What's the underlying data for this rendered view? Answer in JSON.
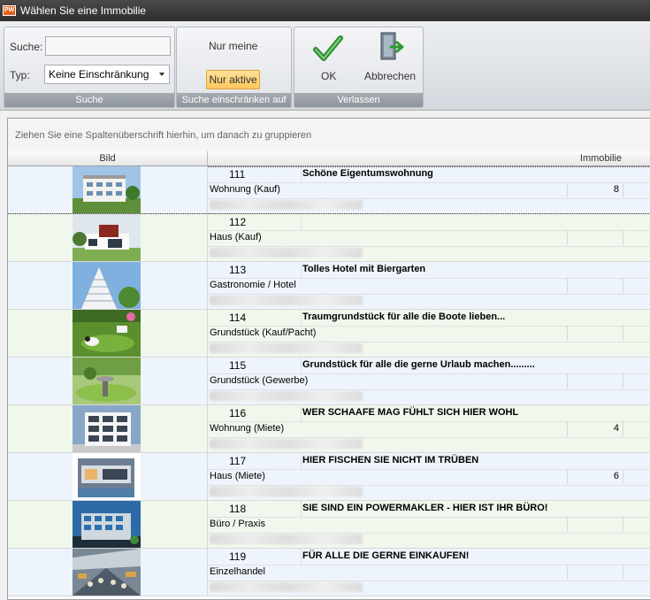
{
  "window": {
    "title": "Wählen Sie eine Immobilie",
    "app_icon_text": "PW"
  },
  "ribbon": {
    "search_group": {
      "search_label": "Suche:",
      "search_value": "",
      "type_label": "Typ:",
      "type_value": "Keine Einschränkung",
      "caption": "Suche"
    },
    "restrict_group": {
      "mine_label": "Nur meine",
      "active_label": "Nur aktive",
      "caption": "Suche einschränken auf"
    },
    "leave_group": {
      "ok_label": "OK",
      "cancel_label": "Abbrechen",
      "caption": "Verlassen"
    }
  },
  "grid": {
    "group_hint": "Ziehen Sie eine Spaltenüberschrift hierhin, um danach zu gruppieren",
    "columns": {
      "image": "Bild",
      "property": "Immobilie"
    },
    "rows": [
      {
        "id": "111",
        "title": "Schöne Eigentumswohnung",
        "type": "Wohnung (Kauf)",
        "count": "8"
      },
      {
        "id": "112",
        "title": "",
        "type": "Haus (Kauf)",
        "count": ""
      },
      {
        "id": "113",
        "title": "Tolles Hotel mit Biergarten",
        "type": "Gastronomie / Hotel",
        "count": ""
      },
      {
        "id": "114",
        "title": "Traumgrundstück für alle die Boote lieben...",
        "type": "Grundstück (Kauf/Pacht)",
        "count": ""
      },
      {
        "id": "115",
        "title": "Grundstück für alle die gerne Urlaub machen.........",
        "type": "Grundstück (Gewerbe)",
        "count": ""
      },
      {
        "id": "116",
        "title": "WER SCHAAFE MAG FÜHLT SICH HIER WOHL",
        "type": "Wohnung (Miete)",
        "count": "4"
      },
      {
        "id": "117",
        "title": "HIER FISCHEN SIE NICHT IM TRÜBEN",
        "type": "Haus (Miete)",
        "count": "6"
      },
      {
        "id": "118",
        "title": "SIE SIND EIN POWERMAKLER - HIER IST IHR BÜRO!",
        "type": "Büro / Praxis",
        "count": ""
      },
      {
        "id": "119",
        "title": "FÜR ALLE DIE GERNE EINKAUFEN!",
        "type": "Einzelhandel",
        "count": ""
      }
    ]
  }
}
